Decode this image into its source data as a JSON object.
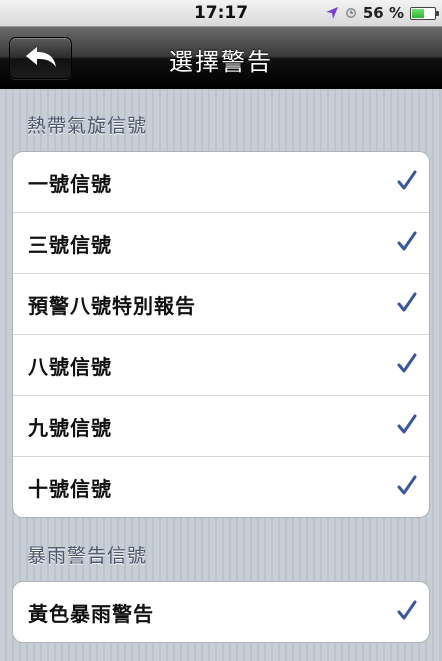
{
  "status_bar": {
    "time": "17:17",
    "battery_label": "56 %",
    "battery_level": 0.56,
    "location_icon": "location-arrow-icon",
    "clock_icon": "alarm-clock-icon"
  },
  "nav": {
    "title": "選擇警告",
    "back_icon": "back-arrow-icon"
  },
  "colors": {
    "check": "#3b5998",
    "section_text": "#4c566c"
  },
  "sections": [
    {
      "header": "熱帶氣旋信號",
      "items": [
        {
          "label": "一號信號",
          "checked": true
        },
        {
          "label": "三號信號",
          "checked": true
        },
        {
          "label": "預警八號特別報告",
          "checked": true
        },
        {
          "label": "八號信號",
          "checked": true
        },
        {
          "label": "九號信號",
          "checked": true
        },
        {
          "label": "十號信號",
          "checked": true
        }
      ]
    },
    {
      "header": "暴雨警告信號",
      "items": [
        {
          "label": "黃色暴雨警告",
          "checked": true
        }
      ]
    }
  ]
}
